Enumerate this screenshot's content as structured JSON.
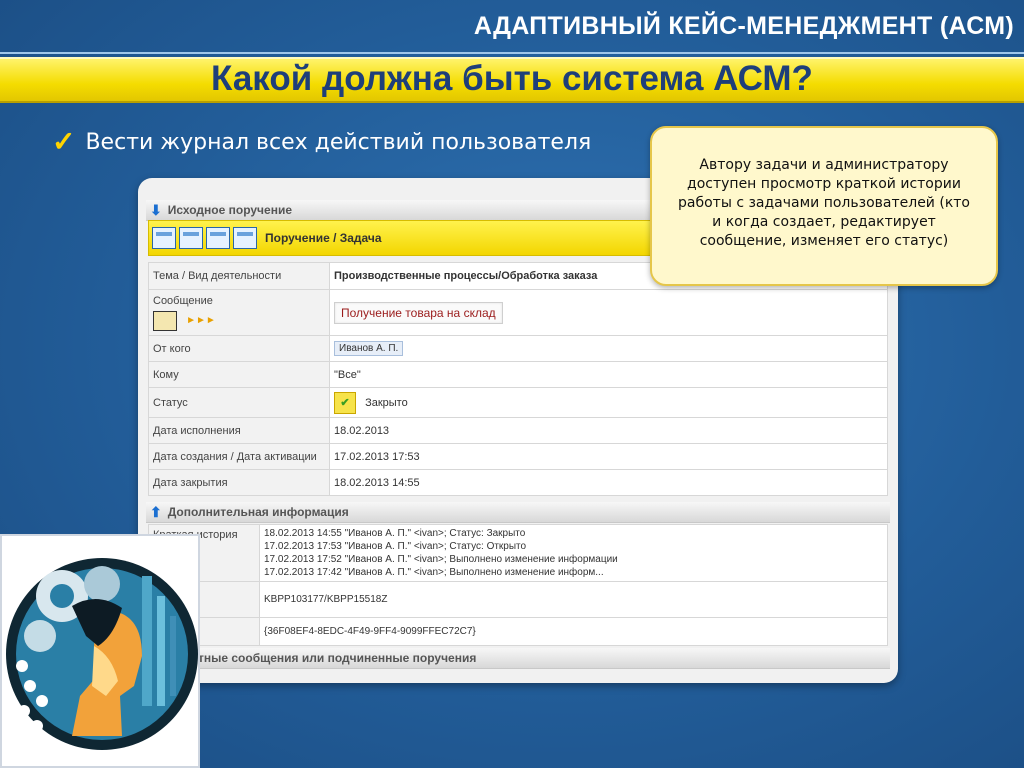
{
  "header": {
    "top_title": "АДАПТИВНЫЙ КЕЙС-МЕНЕДЖМЕНТ (АСМ)",
    "main_title": "Какой должна быть система АСМ?"
  },
  "bullet": {
    "text": "Вести журнал всех действий пользователя"
  },
  "callout": {
    "text": "Автору задачи и администратору доступен просмотр краткой истории работы с задачами пользователей (кто и когда создает, редактирует сообщение, изменяет его статус)"
  },
  "panel": {
    "section1_title": "Исходное поручение",
    "toolbar_title": "Поручение / Задача",
    "fields": {
      "topic_label": "Тема / Вид деятельности",
      "topic_value": "Производственные процессы/Обработка заказа",
      "message_label": "Сообщение",
      "message_value": "Получение товара на склад",
      "from_label": "От кого",
      "from_value": "Иванов А. П.",
      "to_label": "Кому",
      "to_value": "\"Все\"",
      "status_label": "Статус",
      "status_value": "Закрыто",
      "due_label": "Дата исполнения",
      "due_value": "18.02.2013",
      "created_label": "Дата создания / Дата активации",
      "created_value": "17.02.2013 17:53",
      "closed_label": "Дата закрытия",
      "closed_value": "18.02.2013 14:55"
    },
    "section2_title": "Дополнительная информация",
    "history_label": "Краткая история",
    "history": [
      "18.02.2013 14:55 \"Иванов А. П.\" <ivan>; Статус: Закрыто",
      "17.02.2013 17:53 \"Иванов А. П.\" <ivan>; Статус: Открыто",
      "17.02.2013 17:52 \"Иванов А. П.\" <ivan>; Выполнено изменение информации",
      "17.02.2013 17:42 \"Иванов А. П.\" <ivan>; Выполнено изменение информ..."
    ],
    "identifier_label": "икатор",
    "identifier_value": "KBPP103177/KBPP15518Z",
    "guid_value": "{36F08EF4-8EDC-4F49-9FF4-9099FFEC72C7}",
    "section3_title": "тные сообщения или подчиненные поручения"
  },
  "colors": {
    "background": "#225d99",
    "title_bar": "#f4dc00",
    "title_text": "#1e3f7a",
    "callout_bg": "#fff8cc",
    "message_text": "#9b1c1c"
  }
}
